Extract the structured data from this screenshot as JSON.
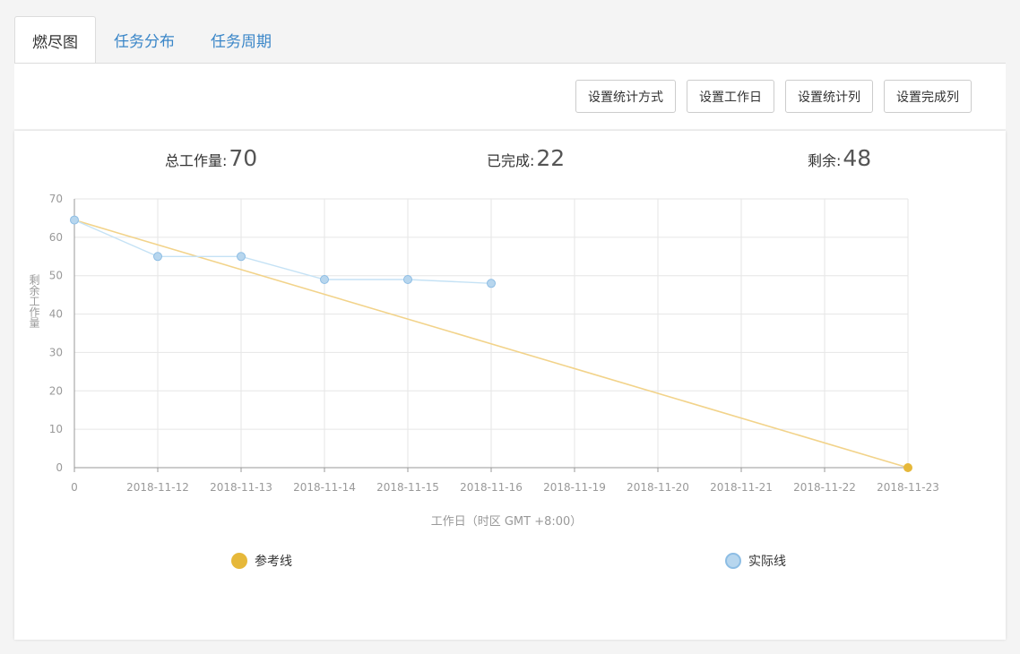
{
  "tabs": [
    {
      "label": "燃尽图",
      "active": true
    },
    {
      "label": "任务分布",
      "active": false
    },
    {
      "label": "任务周期",
      "active": false
    }
  ],
  "toolbar": {
    "stat_mode_label": "设置统计方式",
    "workday_label": "设置工作日",
    "stat_column_label": "设置统计列",
    "done_column_label": "设置完成列"
  },
  "summary": {
    "total_label": "总工作量:",
    "total_value": "70",
    "done_label": "已完成:",
    "done_value": "22",
    "remaining_label": "剩余:",
    "remaining_value": "48"
  },
  "colors": {
    "reference": "#e6b83a",
    "reference_line": "#f2d38a",
    "actual_fill": "#b7d6ee",
    "actual_stroke": "#8dbde4",
    "actual_line": "#c5e2f5",
    "grid": "#e6e6e6",
    "axis": "#999999"
  },
  "chart_data": {
    "type": "line",
    "categories": [
      "0",
      "2018-11-12",
      "2018-11-13",
      "2018-11-14",
      "2018-11-15",
      "2018-11-16",
      "2018-11-19",
      "2018-11-20",
      "2018-11-21",
      "2018-11-22",
      "2018-11-23"
    ],
    "yticks": [
      "0",
      "10",
      "20",
      "30",
      "40",
      "50",
      "60",
      "70"
    ],
    "ylim": [
      0,
      70
    ],
    "ylabel": "剩余工作量",
    "xlabel": "工作日（时区 GMT +8:00）",
    "grid": true,
    "legend_position": "bottom",
    "series": [
      {
        "name": "参考线",
        "values": [
          64.5,
          null,
          null,
          null,
          null,
          null,
          null,
          null,
          null,
          null,
          0
        ],
        "color": "#e6b83a"
      },
      {
        "name": "实际线",
        "values": [
          64.5,
          55,
          55,
          49,
          49,
          48,
          null,
          null,
          null,
          null,
          null
        ],
        "color": "#b7d6ee"
      }
    ]
  }
}
